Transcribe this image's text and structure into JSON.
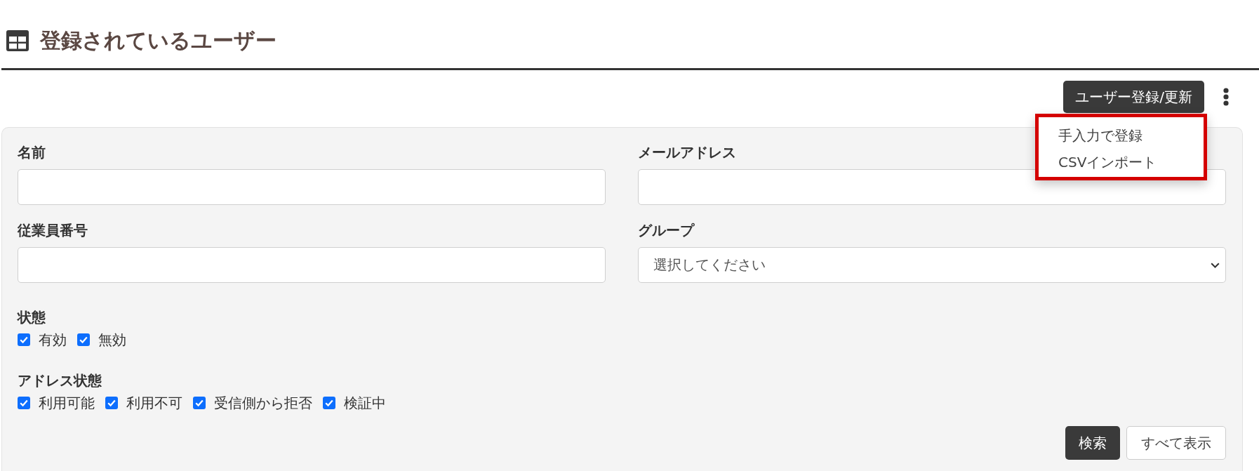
{
  "title": "登録されているユーザー",
  "toolbar": {
    "register_button": "ユーザー登録/更新",
    "menu": {
      "open": true,
      "highlighted": true,
      "items": [
        {
          "label": "手入力で登録"
        },
        {
          "label": "CSVインポート"
        }
      ]
    }
  },
  "search_form": {
    "fields": [
      {
        "label": "名前",
        "kind": "text"
      },
      {
        "label": "メールアドレス",
        "kind": "text"
      },
      {
        "label": "従業員番号",
        "kind": "text"
      },
      {
        "label": "グループ",
        "kind": "select",
        "value": "選択してください"
      }
    ],
    "checkbox_groups": [
      {
        "label": "状態",
        "options": [
          {
            "label": "有効",
            "checked": true
          },
          {
            "label": "無効",
            "checked": true
          }
        ]
      },
      {
        "label": "アドレス状態",
        "options": [
          {
            "label": "利用可能",
            "checked": true
          },
          {
            "label": "利用不可",
            "checked": true
          },
          {
            "label": "受信側から拒否",
            "checked": true
          },
          {
            "label": "検証中",
            "checked": true
          }
        ]
      }
    ],
    "buttons": [
      {
        "label": "検索",
        "kind": "primary"
      },
      {
        "label": "すべて表示",
        "kind": "secondary"
      }
    ]
  }
}
